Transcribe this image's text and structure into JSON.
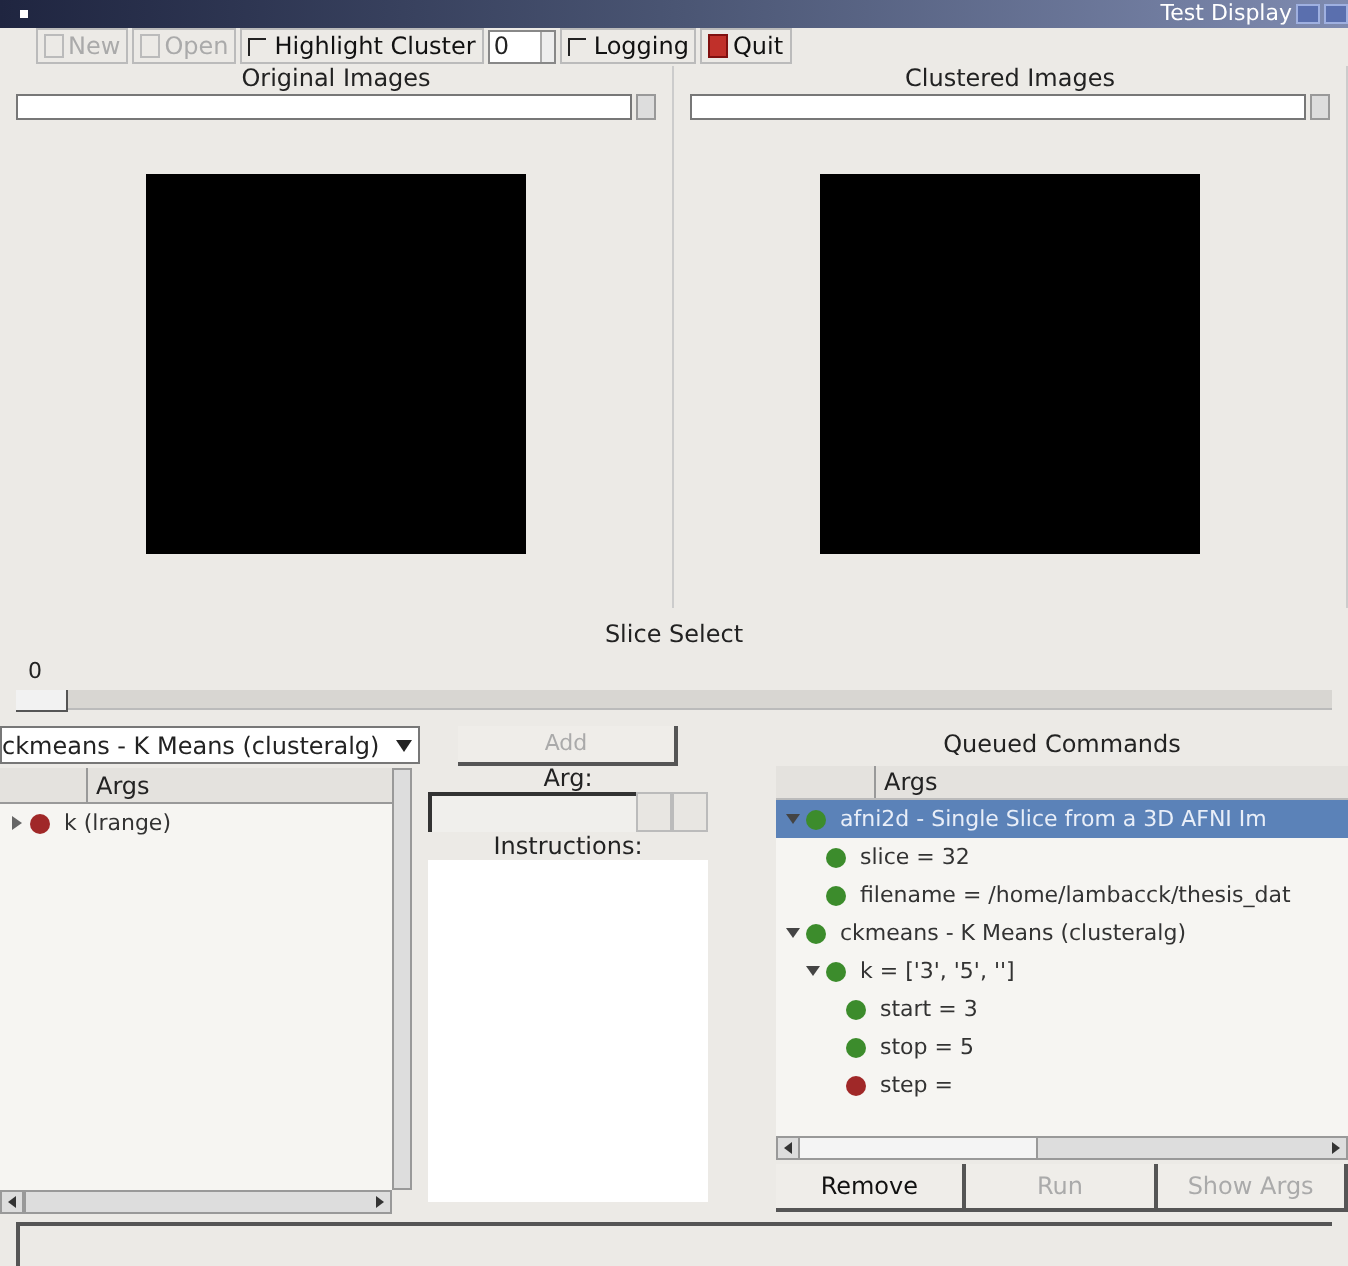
{
  "window": {
    "title": "Test Display"
  },
  "toolbar": [
    {
      "kind": "button",
      "label": "New",
      "disabled": true
    },
    {
      "kind": "button",
      "label": "Open",
      "disabled": true
    },
    {
      "kind": "checkbox",
      "label": "Highlight Cluster",
      "checked": false
    },
    {
      "kind": "spin",
      "value": "0"
    },
    {
      "kind": "checkbox",
      "label": "Logging",
      "checked": false
    },
    {
      "kind": "button",
      "label": "Quit",
      "disabled": false
    }
  ],
  "panes": [
    {
      "title": "Original Images"
    },
    {
      "title": "Clustered Images"
    }
  ],
  "slice_select": {
    "title": "Slice Select",
    "value": "0",
    "level": 0
  },
  "algorithm": {
    "value": "ckmeans - K Means (clusteralg)",
    "column": "Args",
    "items": [
      {
        "label": "k (lrange)",
        "color": "#a02828",
        "expanded": false,
        "selected": false
      }
    ]
  },
  "add_button": {
    "label": "Add",
    "disabled": true
  },
  "arg": {
    "label": "Arg:"
  },
  "instructions": {
    "label": "Instructions:"
  },
  "queue": {
    "title": "Queued Commands",
    "column": "Args",
    "items": [
      {
        "label": "afni2d - Single Slice from a 3D AFNI Im",
        "color": "#3c8c2c",
        "expanded": true,
        "selected": true,
        "children": [
          {
            "label": "slice = 32",
            "color": "#3c8c2c",
            "selected": false
          },
          {
            "label": "filename = /home/lambacck/thesis_dat",
            "color": "#3c8c2c",
            "selected": false
          }
        ]
      },
      {
        "label": "ckmeans - K Means (clusteralg)",
        "color": "#3c8c2c",
        "expanded": true,
        "selected": false,
        "children": [
          {
            "label": "k = ['3', '5', '']",
            "color": "#3c8c2c",
            "expanded": true,
            "selected": false,
            "children": [
              {
                "label": "start = 3",
                "color": "#3c8c2c",
                "selected": false
              },
              {
                "label": "stop = 5",
                "color": "#3c8c2c",
                "selected": false
              },
              {
                "label": "step =",
                "color": "#a02828",
                "selected": false
              }
            ]
          }
        ]
      }
    ]
  },
  "queue_buttons": [
    {
      "label": "Remove",
      "disabled": false
    },
    {
      "label": "Run",
      "disabled": true
    },
    {
      "label": "Show Args",
      "disabled": true
    }
  ]
}
